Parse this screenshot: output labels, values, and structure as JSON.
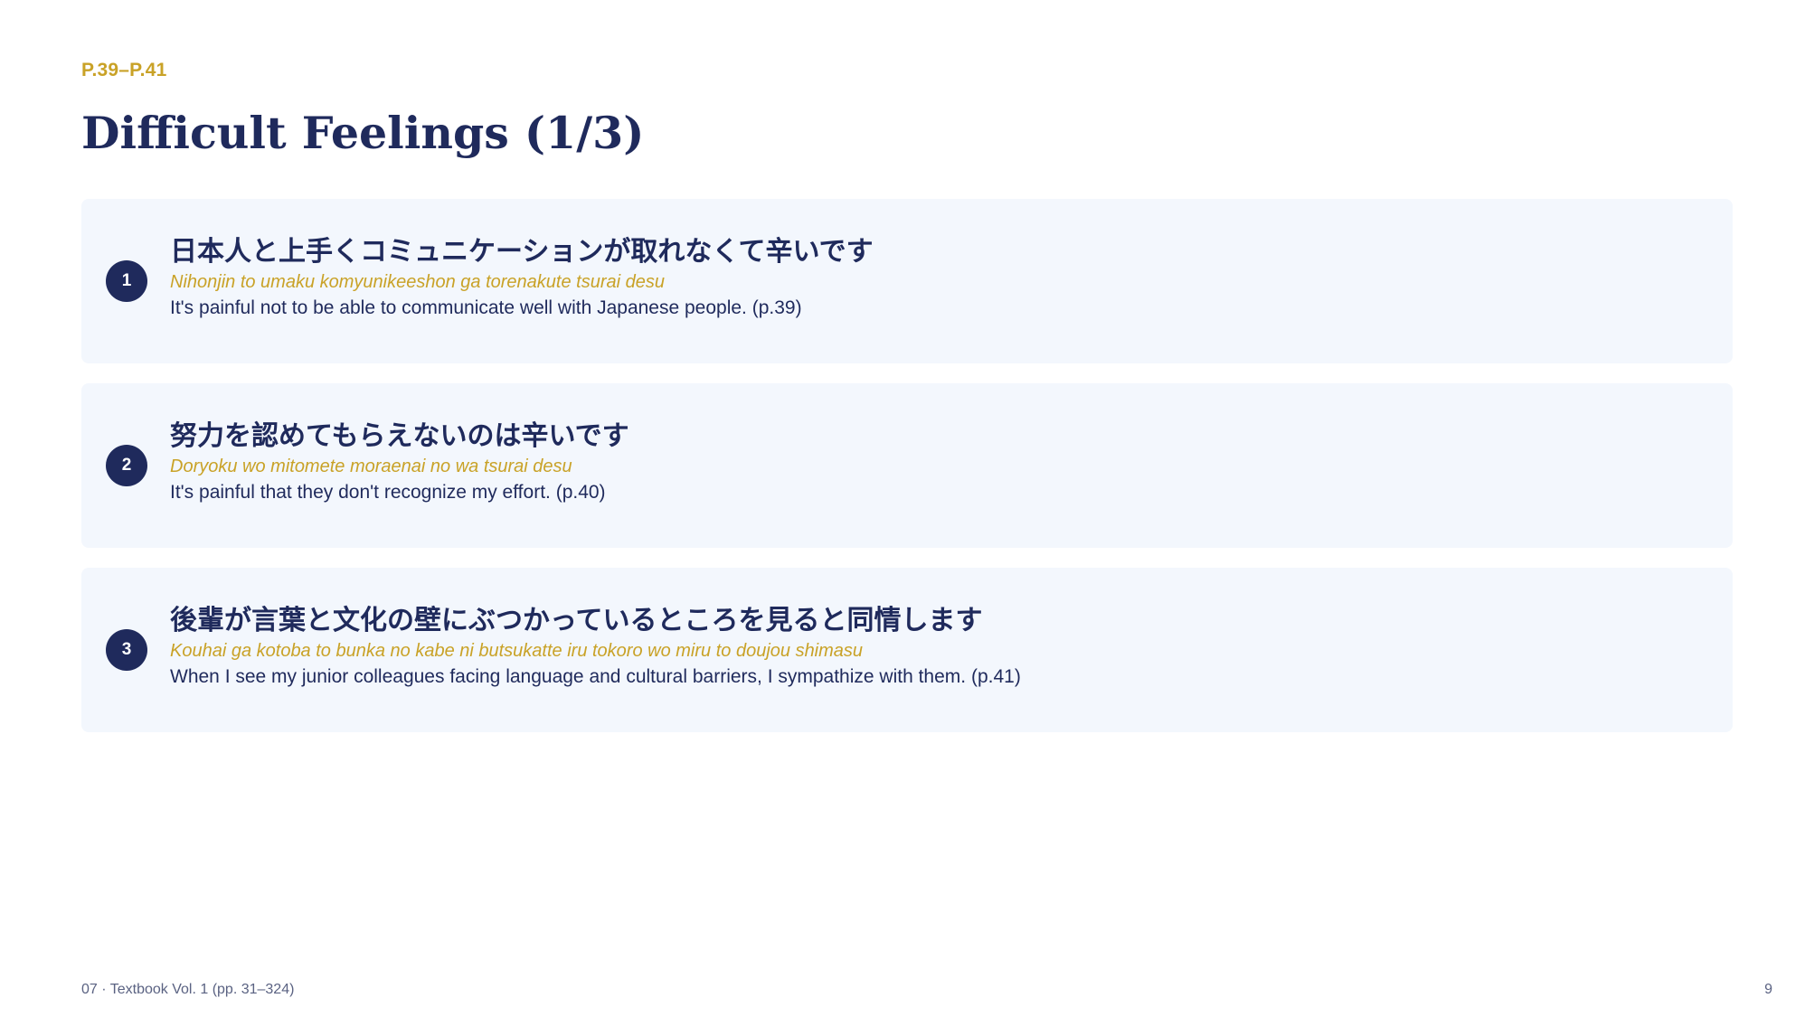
{
  "header": {
    "page_range": "P.39–P.41",
    "title": "Difficult Feelings (1/3)"
  },
  "phrases": [
    {
      "number": "1",
      "japanese": "日本人と上手くコミュニケーションが取れなくて辛いです",
      "romaji": "Nihonjin to umaku komyunikeeshon ga torenakute tsurai desu",
      "english": "It's painful not to be able to communicate well with Japanese people. (p.39)"
    },
    {
      "number": "2",
      "japanese": "努力を認めてもらえないのは辛いです",
      "romaji": "Doryoku wo mitomete moraenai no wa tsurai desu",
      "english": "It's painful that they don't recognize my effort. (p.40)"
    },
    {
      "number": "3",
      "japanese": "後輩が言葉と文化の壁にぶつかっているところを見ると同情します",
      "romaji": "Kouhai ga kotoba to bunka no kabe ni butsukatte iru tokoro wo miru to doujou shimasu",
      "english": "When I see my junior colleagues facing language and cultural barriers, I sympathize with them. (p.41)"
    }
  ],
  "footer": {
    "source": "07 · Textbook Vol. 1 (pp. 31–324)",
    "page_number": "9"
  },
  "colors": {
    "navy": "#1f2a5c",
    "gold": "#c9a227",
    "card_background": "#f3f7fd"
  }
}
